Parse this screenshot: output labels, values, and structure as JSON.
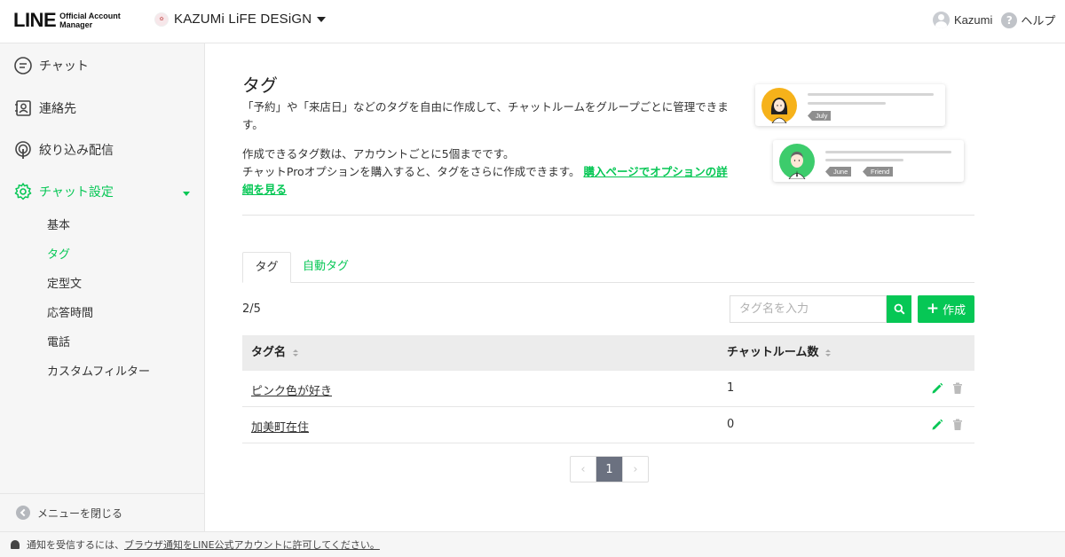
{
  "header": {
    "logo_main": "LINE",
    "logo_sub_1": "Official Account",
    "logo_sub_2": "Manager",
    "account_name": "KAZUMi LiFE DESiGN",
    "user_name": "Kazumi",
    "help_label": "ヘルプ"
  },
  "sidebar": {
    "items": [
      {
        "label": "チャット",
        "icon": "chat-icon"
      },
      {
        "label": "連絡先",
        "icon": "contacts-icon"
      },
      {
        "label": "絞り込み配信",
        "icon": "broadcast-icon"
      },
      {
        "label": "チャット設定",
        "icon": "gear-icon"
      }
    ],
    "subitems": [
      "基本",
      "タグ",
      "定型文",
      "応答時間",
      "電話",
      "カスタムフィルター"
    ],
    "close_label": "メニューを閉じる"
  },
  "page": {
    "title": "タグ",
    "description": "「予約」や「来店日」などのタグを自由に作成して、チャットルームをグループごとに管理できます。",
    "info_line1": "作成できるタグ数は、アカウントごとに5個までです。",
    "info_line2": "チャットProオプションを購入すると、タグをさらに作成できます。",
    "info_link": "購入ページでオプションの詳細を見る"
  },
  "illustration": {
    "card1_tags": [
      "July"
    ],
    "card2_tags": [
      "June",
      "Friend"
    ]
  },
  "tabs": [
    "タグ",
    "自動タグ"
  ],
  "toolbar": {
    "count": "2/5",
    "search_placeholder": "タグ名を入力",
    "create_label": "作成"
  },
  "table": {
    "headers": [
      "タグ名",
      "チャットルーム数"
    ],
    "rows": [
      {
        "name": "ピンク色が好き",
        "count": "1"
      },
      {
        "name": "加美町在住",
        "count": "0"
      }
    ]
  },
  "pagination": {
    "current": "1",
    "prev": "‹",
    "next": "›"
  },
  "notice": {
    "text": "通知を受信するには、",
    "link": "ブラウザ通知をLINE公式アカウントに許可してください。"
  },
  "colors": {
    "accent": "#06c755",
    "pager_active": "#6b7180"
  }
}
